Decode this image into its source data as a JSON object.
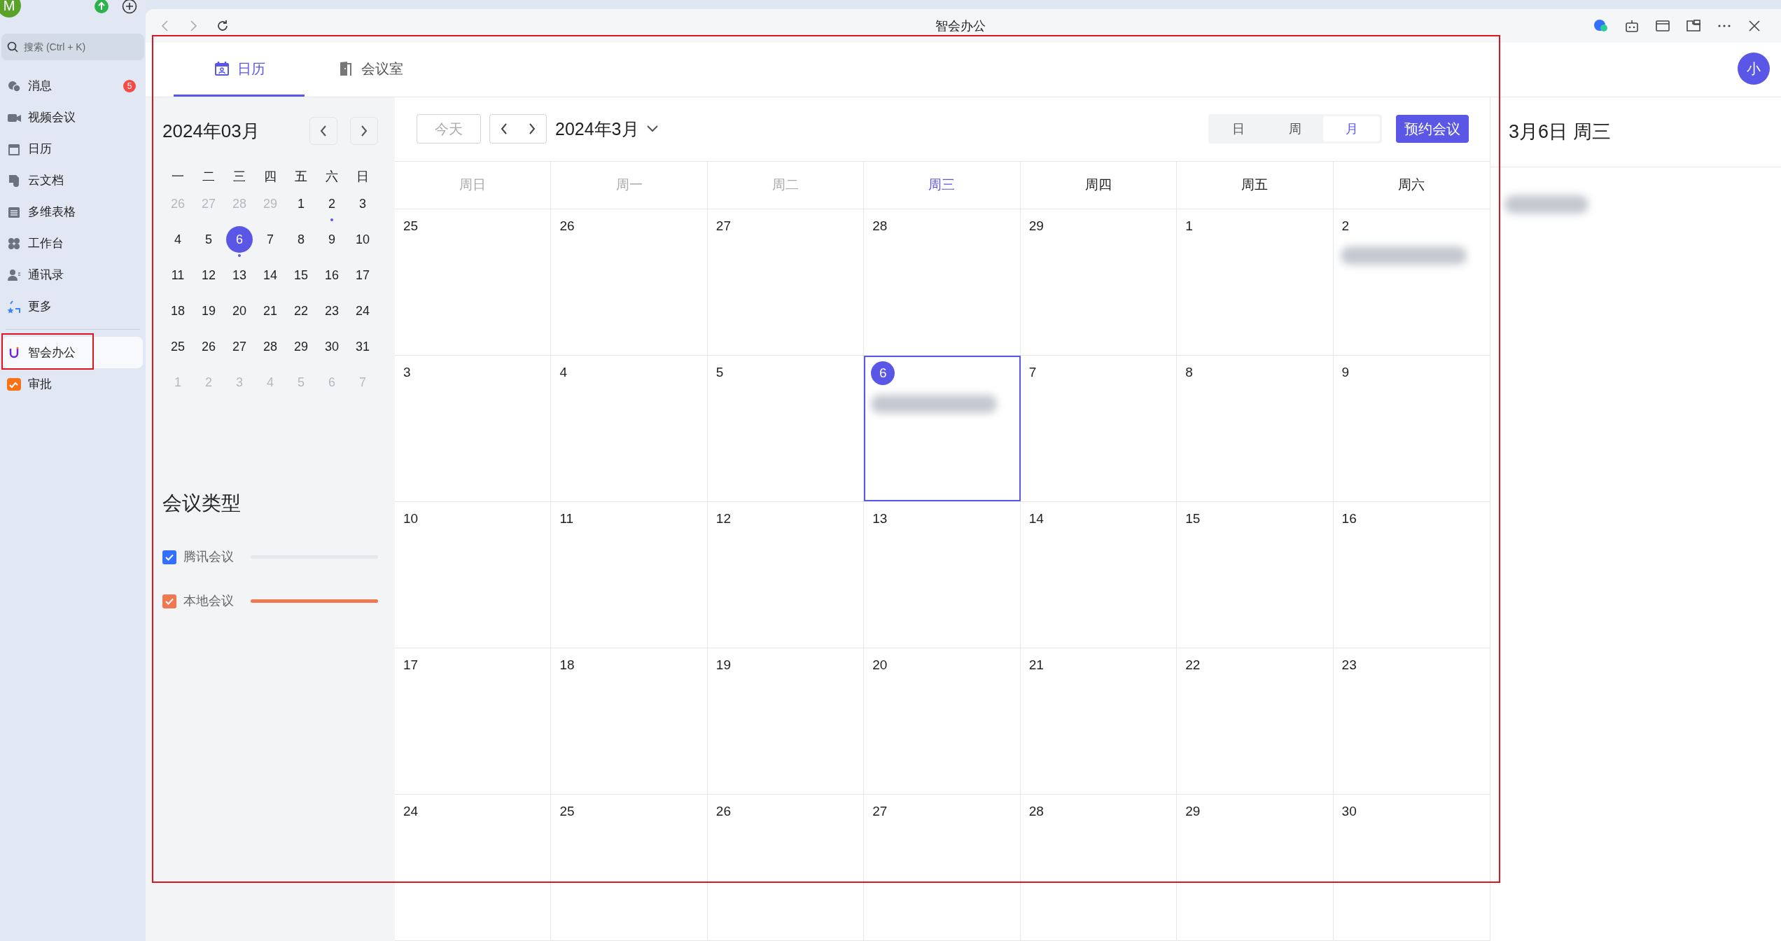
{
  "sidebar": {
    "avatar": "M",
    "search": {
      "placeholder": "搜索 (Ctrl + K)"
    },
    "items": [
      {
        "label": "消息",
        "badge": "5",
        "selected": false,
        "highlighted": false
      },
      {
        "label": "视频会议",
        "selected": false,
        "highlighted": false
      },
      {
        "label": "日历",
        "selected": false,
        "highlighted": false
      },
      {
        "label": "云文档",
        "selected": false,
        "highlighted": false
      },
      {
        "label": "多维表格",
        "selected": false,
        "highlighted": false
      },
      {
        "label": "工作台",
        "selected": false,
        "highlighted": false
      },
      {
        "label": "通讯录",
        "selected": false,
        "highlighted": false
      },
      {
        "label": "更多",
        "selected": false,
        "highlighted": false
      }
    ],
    "apps": [
      {
        "label": "智会办公",
        "selected": true,
        "highlighted": true
      },
      {
        "label": "审批",
        "selected": false,
        "highlighted": false
      }
    ]
  },
  "titlebar": {
    "title": "智会办公"
  },
  "tabs": [
    {
      "label": "日历",
      "selected": true
    },
    {
      "label": "会议室",
      "selected": false
    }
  ],
  "user_avatar": "小",
  "content_highlighted": true,
  "mini_calendar": {
    "title": "2024年03月",
    "weekdays": [
      "一",
      "二",
      "三",
      "四",
      "五",
      "六",
      "日"
    ],
    "weeks": [
      [
        {
          "label": "26",
          "muted": true,
          "selected": false,
          "dot": false
        },
        {
          "label": "27",
          "muted": true,
          "selected": false,
          "dot": false
        },
        {
          "label": "28",
          "muted": true,
          "selected": false,
          "dot": false
        },
        {
          "label": "29",
          "muted": true,
          "selected": false,
          "dot": false
        },
        {
          "label": "1",
          "muted": false,
          "selected": false,
          "dot": false
        },
        {
          "label": "2",
          "muted": false,
          "selected": false,
          "dot": true
        },
        {
          "label": "3",
          "muted": false,
          "selected": false,
          "dot": false
        }
      ],
      [
        {
          "label": "4",
          "muted": false,
          "selected": false,
          "dot": false
        },
        {
          "label": "5",
          "muted": false,
          "selected": false,
          "dot": false
        },
        {
          "label": "6",
          "muted": false,
          "selected": true,
          "dot": true
        },
        {
          "label": "7",
          "muted": false,
          "selected": false,
          "dot": false
        },
        {
          "label": "8",
          "muted": false,
          "selected": false,
          "dot": false
        },
        {
          "label": "9",
          "muted": false,
          "selected": false,
          "dot": false
        },
        {
          "label": "10",
          "muted": false,
          "selected": false,
          "dot": false
        }
      ],
      [
        {
          "label": "11",
          "muted": false,
          "selected": false,
          "dot": false
        },
        {
          "label": "12",
          "muted": false,
          "selected": false,
          "dot": false
        },
        {
          "label": "13",
          "muted": false,
          "selected": false,
          "dot": false
        },
        {
          "label": "14",
          "muted": false,
          "selected": false,
          "dot": false
        },
        {
          "label": "15",
          "muted": false,
          "selected": false,
          "dot": false
        },
        {
          "label": "16",
          "muted": false,
          "selected": false,
          "dot": false
        },
        {
          "label": "17",
          "muted": false,
          "selected": false,
          "dot": false
        }
      ],
      [
        {
          "label": "18",
          "muted": false,
          "selected": false,
          "dot": false
        },
        {
          "label": "19",
          "muted": false,
          "selected": false,
          "dot": false
        },
        {
          "label": "20",
          "muted": false,
          "selected": false,
          "dot": false
        },
        {
          "label": "21",
          "muted": false,
          "selected": false,
          "dot": false
        },
        {
          "label": "22",
          "muted": false,
          "selected": false,
          "dot": false
        },
        {
          "label": "23",
          "muted": false,
          "selected": false,
          "dot": false
        },
        {
          "label": "24",
          "muted": false,
          "selected": false,
          "dot": false
        }
      ],
      [
        {
          "label": "25",
          "muted": false,
          "selected": false,
          "dot": false
        },
        {
          "label": "26",
          "muted": false,
          "selected": false,
          "dot": false
        },
        {
          "label": "27",
          "muted": false,
          "selected": false,
          "dot": false
        },
        {
          "label": "28",
          "muted": false,
          "selected": false,
          "dot": false
        },
        {
          "label": "29",
          "muted": false,
          "selected": false,
          "dot": false
        },
        {
          "label": "30",
          "muted": false,
          "selected": false,
          "dot": false
        },
        {
          "label": "31",
          "muted": false,
          "selected": false,
          "dot": false
        }
      ],
      [
        {
          "label": "1",
          "muted": true,
          "selected": false,
          "dot": false
        },
        {
          "label": "2",
          "muted": true,
          "selected": false,
          "dot": false
        },
        {
          "label": "3",
          "muted": true,
          "selected": false,
          "dot": false
        },
        {
          "label": "4",
          "muted": true,
          "selected": false,
          "dot": false
        },
        {
          "label": "5",
          "muted": true,
          "selected": false,
          "dot": false
        },
        {
          "label": "6",
          "muted": true,
          "selected": false,
          "dot": false
        },
        {
          "label": "7",
          "muted": true,
          "selected": false,
          "dot": false
        }
      ]
    ]
  },
  "meeting_types": {
    "title": "会议类型",
    "items": [
      {
        "label": "腾讯会议",
        "checked": true,
        "color": "#3370ff",
        "line_active": false
      },
      {
        "label": "本地会议",
        "checked": true,
        "color": "#f07850",
        "line_active": true
      }
    ]
  },
  "toolbar": {
    "today": "今天",
    "month_label": "2024年3月",
    "views": [
      {
        "label": "日",
        "selected": false
      },
      {
        "label": "周",
        "selected": false
      },
      {
        "label": "月",
        "selected": true
      }
    ],
    "book_button": "预约会议"
  },
  "week_headers": [
    {
      "label": "周日",
      "kind": "past"
    },
    {
      "label": "周一",
      "kind": "past"
    },
    {
      "label": "周二",
      "kind": "past"
    },
    {
      "label": "周三",
      "kind": "today"
    },
    {
      "label": "周四",
      "kind": "future"
    },
    {
      "label": "周五",
      "kind": "future"
    },
    {
      "label": "周六",
      "kind": "future"
    }
  ],
  "weeks": [
    [
      {
        "day": "25",
        "today": false,
        "blurred_event": false
      },
      {
        "day": "26",
        "today": false,
        "blurred_event": false
      },
      {
        "day": "27",
        "today": false,
        "blurred_event": false
      },
      {
        "day": "28",
        "today": false,
        "blurred_event": false
      },
      {
        "day": "29",
        "today": false,
        "blurred_event": false
      },
      {
        "day": "1",
        "today": false,
        "blurred_event": false
      },
      {
        "day": "2",
        "today": false,
        "blurred_event": true
      }
    ],
    [
      {
        "day": "3",
        "today": false,
        "blurred_event": false
      },
      {
        "day": "4",
        "today": false,
        "blurred_event": false
      },
      {
        "day": "5",
        "today": false,
        "blurred_event": false
      },
      {
        "day": "6",
        "today": true,
        "blurred_event": true
      },
      {
        "day": "7",
        "today": false,
        "blurred_event": false
      },
      {
        "day": "8",
        "today": false,
        "blurred_event": false
      },
      {
        "day": "9",
        "today": false,
        "blurred_event": false
      }
    ],
    [
      {
        "day": "10",
        "today": false,
        "blurred_event": false
      },
      {
        "day": "11",
        "today": false,
        "blurred_event": false
      },
      {
        "day": "12",
        "today": false,
        "blurred_event": false
      },
      {
        "day": "13",
        "today": false,
        "blurred_event": false
      },
      {
        "day": "14",
        "today": false,
        "blurred_event": false
      },
      {
        "day": "15",
        "today": false,
        "blurred_event": false
      },
      {
        "day": "16",
        "today": false,
        "blurred_event": false
      }
    ],
    [
      {
        "day": "17",
        "today": false,
        "blurred_event": false
      },
      {
        "day": "18",
        "today": false,
        "blurred_event": false
      },
      {
        "day": "19",
        "today": false,
        "blurred_event": false
      },
      {
        "day": "20",
        "today": false,
        "blurred_event": false
      },
      {
        "day": "21",
        "today": false,
        "blurred_event": false
      },
      {
        "day": "22",
        "today": false,
        "blurred_event": false
      },
      {
        "day": "23",
        "today": false,
        "blurred_event": false
      }
    ],
    [
      {
        "day": "24",
        "today": false,
        "blurred_event": false
      },
      {
        "day": "25",
        "today": false,
        "blurred_event": false
      },
      {
        "day": "26",
        "today": false,
        "blurred_event": false
      },
      {
        "day": "27",
        "today": false,
        "blurred_event": false
      },
      {
        "day": "28",
        "today": false,
        "blurred_event": false
      },
      {
        "day": "29",
        "today": false,
        "blurred_event": false
      },
      {
        "day": "30",
        "today": false,
        "blurred_event": false
      }
    ]
  ],
  "day_panel": {
    "title": "3月6日 周三",
    "blurred_event": true
  }
}
